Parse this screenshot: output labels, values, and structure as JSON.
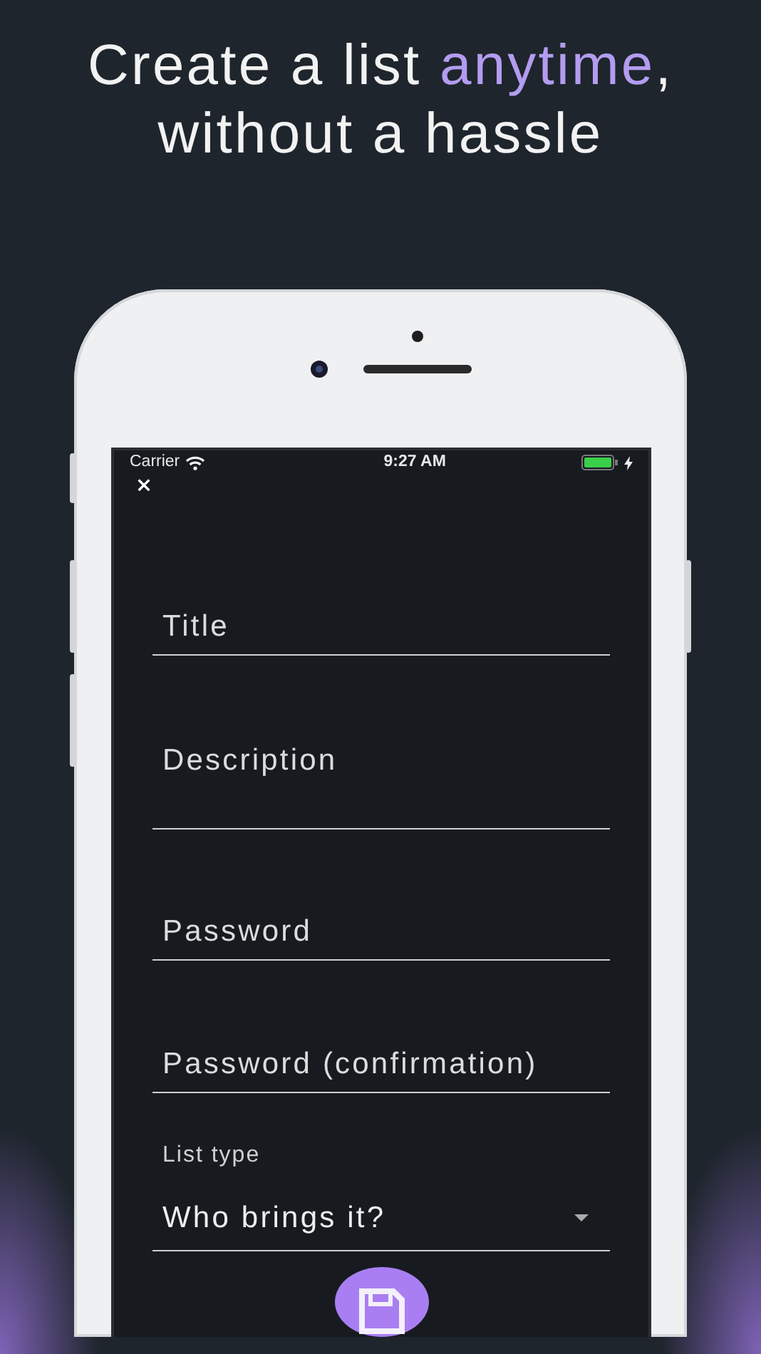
{
  "headline": {
    "lines": [
      [
        {
          "text": "Create a list ",
          "highlight": false
        },
        {
          "text": "anytime",
          "highlight": true
        },
        {
          "text": ",",
          "highlight": false
        }
      ],
      [
        {
          "text": "without a hassle",
          "highlight": false
        }
      ]
    ]
  },
  "status_bar": {
    "carrier": "Carrier",
    "time": "9:27 AM",
    "battery_charging": true
  },
  "form": {
    "fields": [
      {
        "kind": "text",
        "placeholder": "Title"
      },
      {
        "kind": "textarea",
        "placeholder": "Description"
      },
      {
        "kind": "password",
        "placeholder": "Password"
      },
      {
        "kind": "password",
        "placeholder": "Password (confirmation)"
      },
      {
        "kind": "select",
        "label": "List type",
        "value": "Who brings it?"
      }
    ]
  }
}
